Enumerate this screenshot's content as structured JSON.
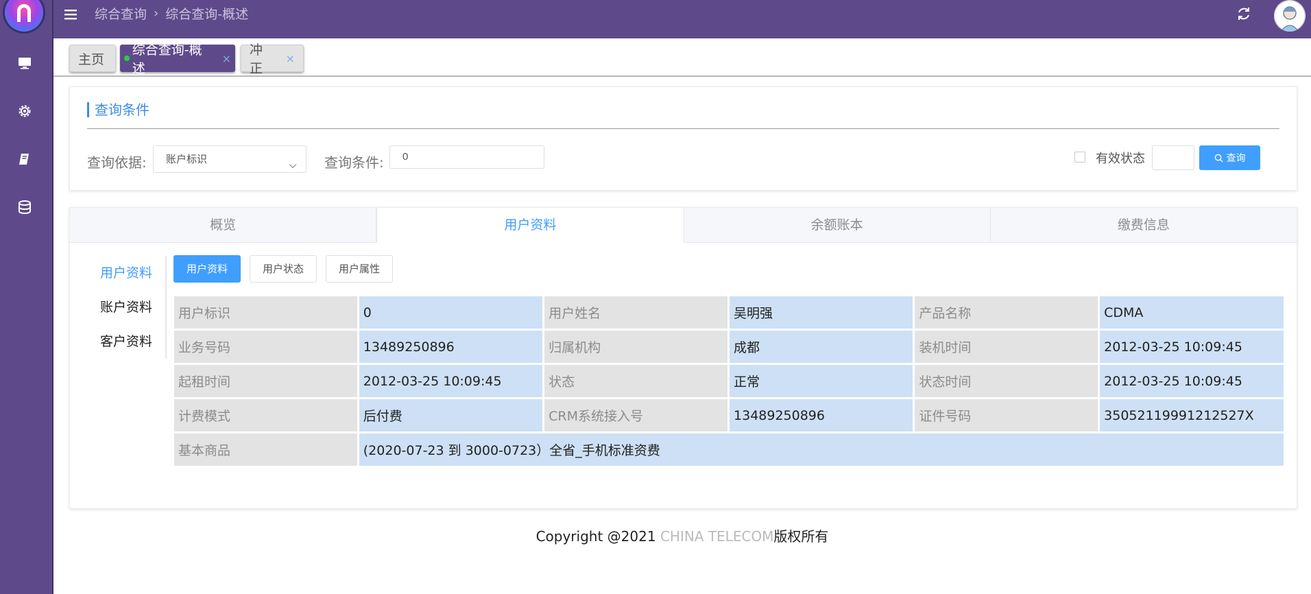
{
  "colors": {
    "sidebar": "#5e4a8a",
    "accent": "#409eff",
    "value_cell": "#cde0f5",
    "key_cell": "#e3e3e3"
  },
  "sidebar": {
    "icons": [
      "monitor-icon",
      "gear-icon",
      "book-icon",
      "database-icon"
    ]
  },
  "header": {
    "breadcrumb": [
      "综合查询",
      "综合查询-概述"
    ]
  },
  "open_tabs": [
    {
      "label": "主页"
    },
    {
      "label": "综合查询-概述",
      "close": "×"
    },
    {
      "label": "冲正",
      "close": "×"
    }
  ],
  "query": {
    "title": "查询条件",
    "basis_label": "查询依据:",
    "basis_value": "账户标识",
    "condition_label": "查询条件:",
    "condition_value": "0",
    "valid_label": "有效状态",
    "search_label": "查询"
  },
  "main_tabs": [
    "概览",
    "用户资料",
    "余额账本",
    "缴费信息"
  ],
  "side_menu": [
    "用户资料",
    "账户资料",
    "客户资料"
  ],
  "sub_buttons": [
    "用户资料",
    "用户状态",
    "用户属性"
  ],
  "info": {
    "rows": [
      [
        {
          "k": "用户标识",
          "v": "0"
        },
        {
          "k": "用户姓名",
          "v": "吴明强"
        },
        {
          "k": "产品名称",
          "v": "CDMA"
        }
      ],
      [
        {
          "k": "业务号码",
          "v": "13489250896"
        },
        {
          "k": "归属机构",
          "v": "成都"
        },
        {
          "k": "装机时间",
          "v": "2012-03-25 10:09:45"
        }
      ],
      [
        {
          "k": "起租时间",
          "v": "2012-03-25 10:09:45"
        },
        {
          "k": "状态",
          "v": "正常"
        },
        {
          "k": "状态时间",
          "v": "2012-03-25 10:09:45"
        }
      ],
      [
        {
          "k": "计费模式",
          "v": "后付费"
        },
        {
          "k": "CRM系统接入号",
          "v": "13489250896"
        },
        {
          "k": "证件号码",
          "v": "35052119991212527X"
        }
      ]
    ],
    "goods_label": "基本商品",
    "goods_value": "(2020-07-23 到 3000-0723）全省_手机标准资费"
  },
  "footer": {
    "prefix": "Copyright @2021 ",
    "brand": "CHINA TELECOM",
    "suffix": "版权所有"
  }
}
